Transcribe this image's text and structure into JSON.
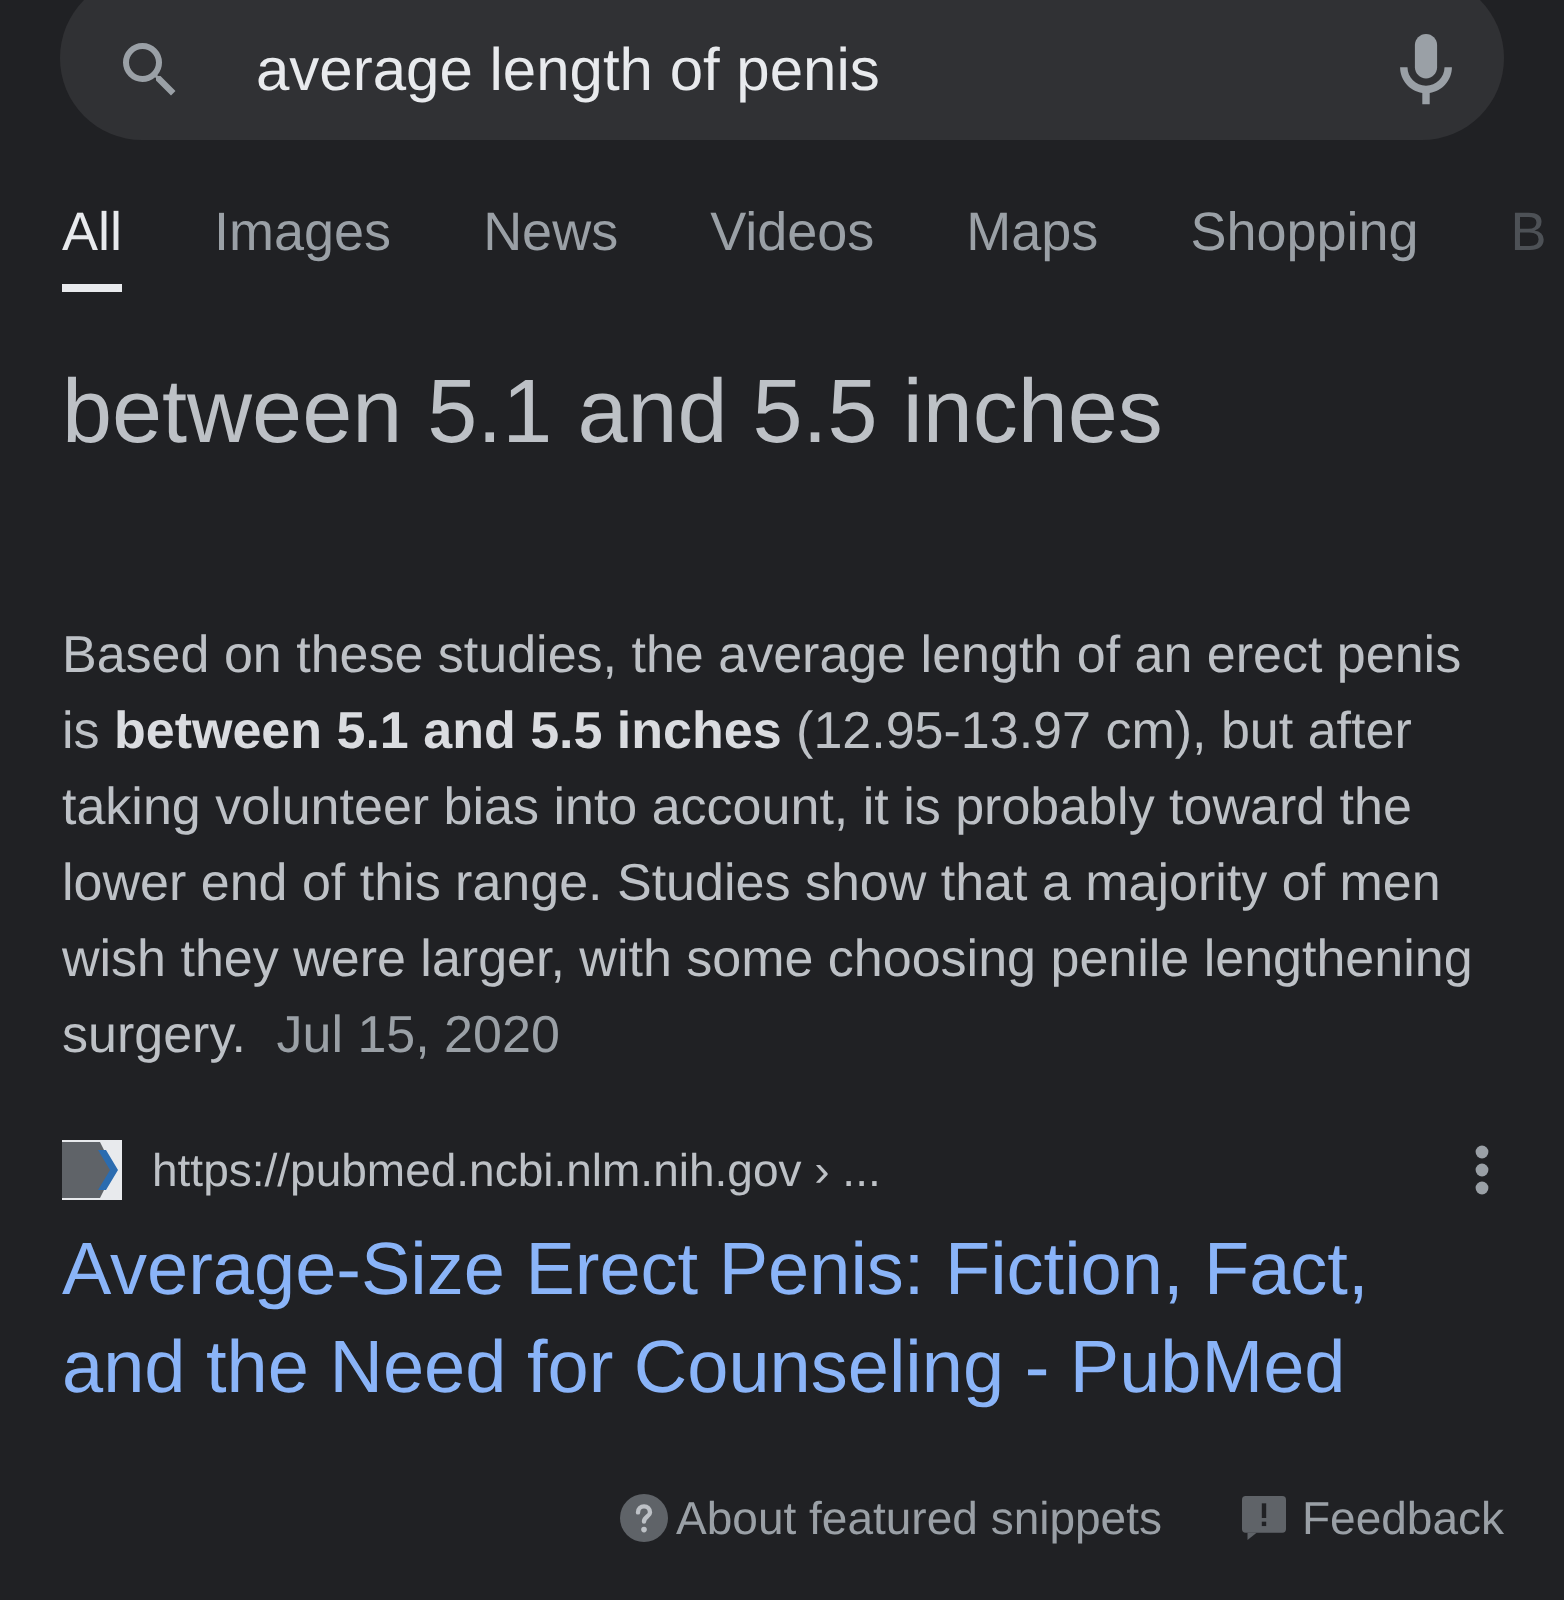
{
  "search": {
    "query": "average length of penis"
  },
  "tabs": [
    {
      "label": "All",
      "selected": true
    },
    {
      "label": "Images",
      "selected": false
    },
    {
      "label": "News",
      "selected": false
    },
    {
      "label": "Videos",
      "selected": false
    },
    {
      "label": "Maps",
      "selected": false
    },
    {
      "label": "Shopping",
      "selected": false
    },
    {
      "label": "B",
      "selected": false
    }
  ],
  "featured_snippet": {
    "answer": "between 5.1 and 5.5 inches",
    "text": "Based on these studies, the average length of an erect penis is **between 5.1 and 5.5 inches** (12.95-13.97 cm), but after taking volunteer bias into account, it is probably toward the lower end of this range. Studies show that a majority of men wish they were larger, with some choosing penile lengthening surgery.",
    "date": "Jul 15, 2020"
  },
  "source": {
    "url": "https://pubmed.ncbi.nlm.nih.gov › ...",
    "title": "Average-Size Erect Penis: Fiction, Fact, and the Need for Counseling - PubMed"
  },
  "footer": {
    "about": "About featured snippets",
    "feedback": "Feedback"
  }
}
